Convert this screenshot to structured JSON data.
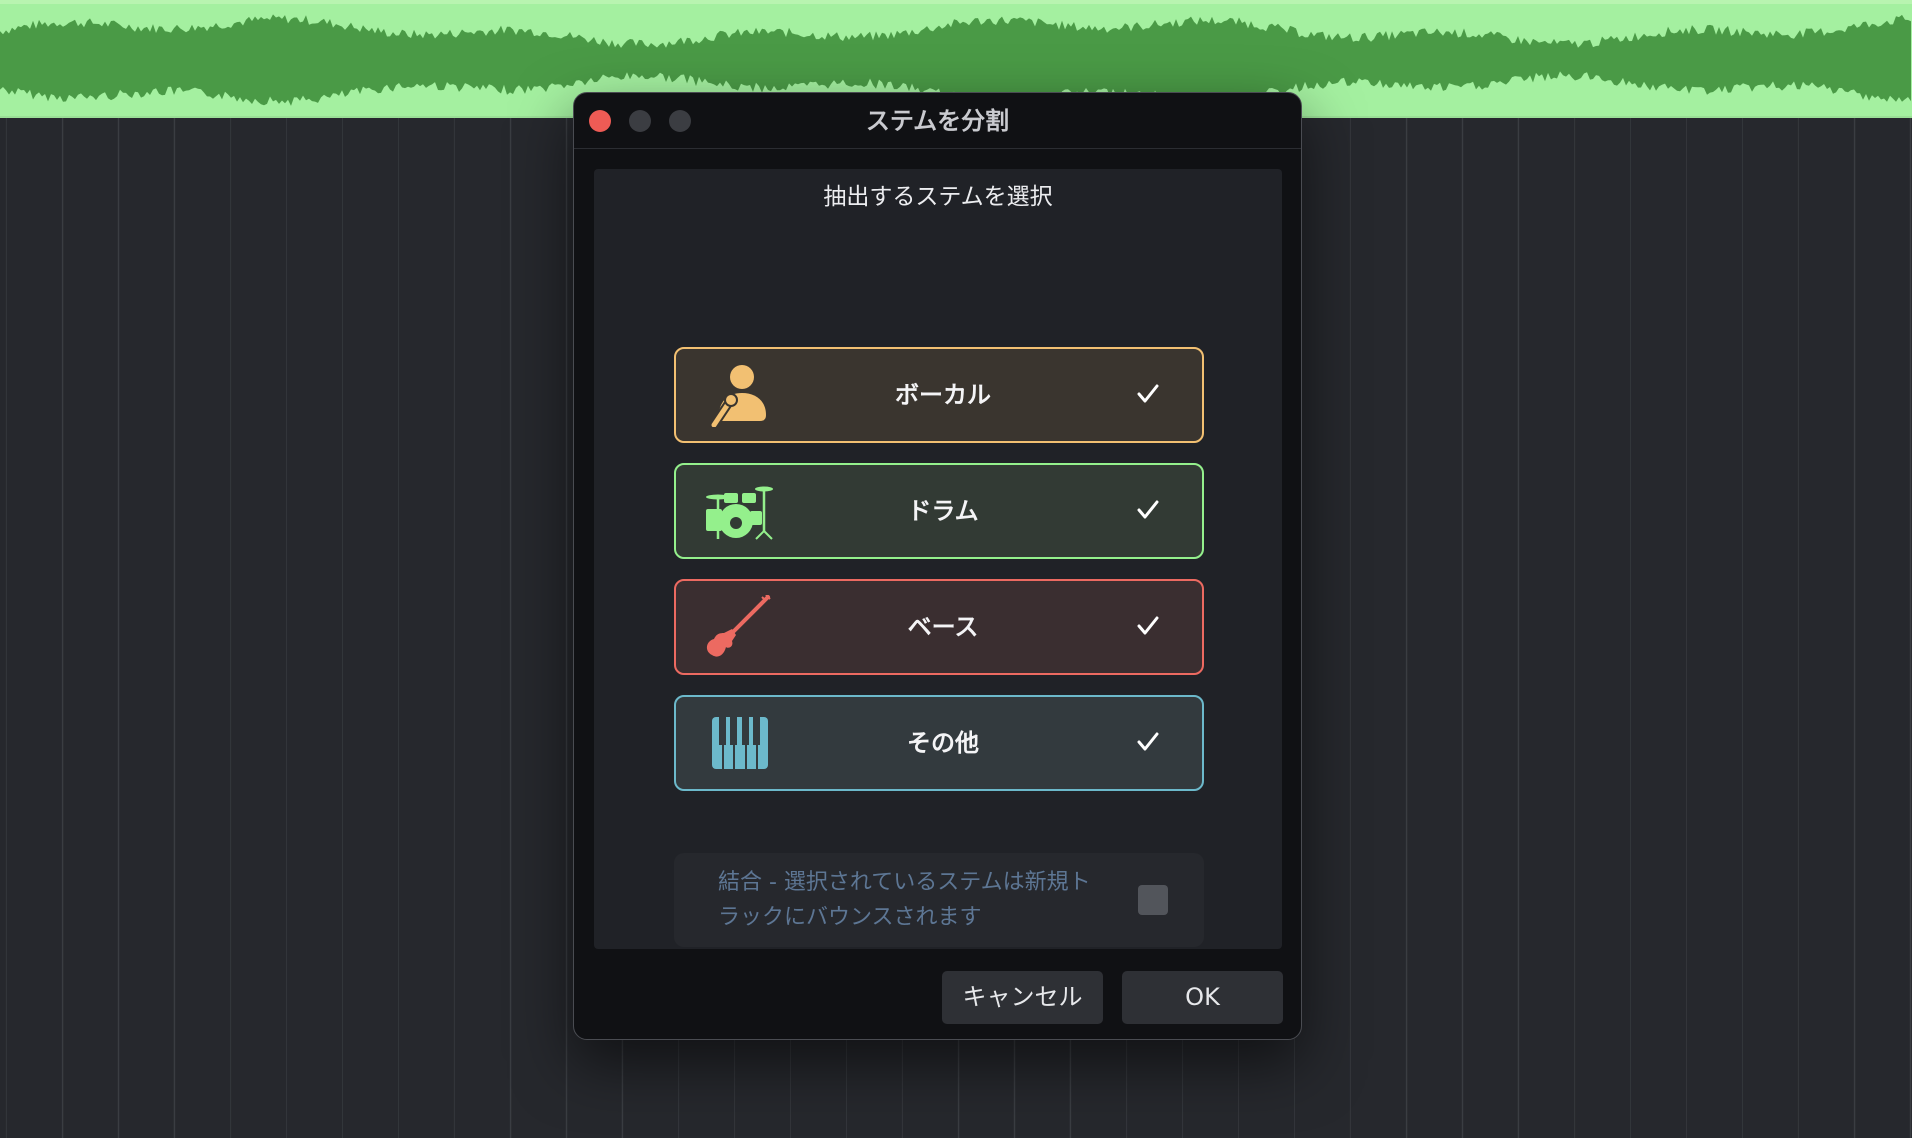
{
  "colors": {
    "waveform_bg": "#a4f0a0",
    "waveform_fg": "#4a9a46",
    "arrange_bg": "#26282d",
    "dialog_bg": "#101114",
    "panel_bg": "#202227",
    "vocals_accent": "#f2c072",
    "drums_accent": "#94f08c",
    "bass_accent": "#ec6a61",
    "other_accent": "#6cb9cb",
    "close_button": "#ee5b55"
  },
  "dialog": {
    "title": "ステムを分割",
    "heading": "抽出するステムを選択",
    "stems": [
      {
        "label": "ボーカル",
        "icon": "singer-microphone-icon",
        "checked": true
      },
      {
        "label": "ドラム",
        "icon": "drum-kit-icon",
        "checked": true
      },
      {
        "label": "ベース",
        "icon": "bass-guitar-icon",
        "checked": true
      },
      {
        "label": "その他",
        "icon": "piano-keys-icon",
        "checked": true
      }
    ],
    "combine": {
      "line1": "結合 - 選択されているステムは新規ト",
      "line2": "ラックにバウンスされます",
      "checked": false
    },
    "buttons": {
      "cancel": "キャンセル",
      "ok": "OK"
    }
  }
}
